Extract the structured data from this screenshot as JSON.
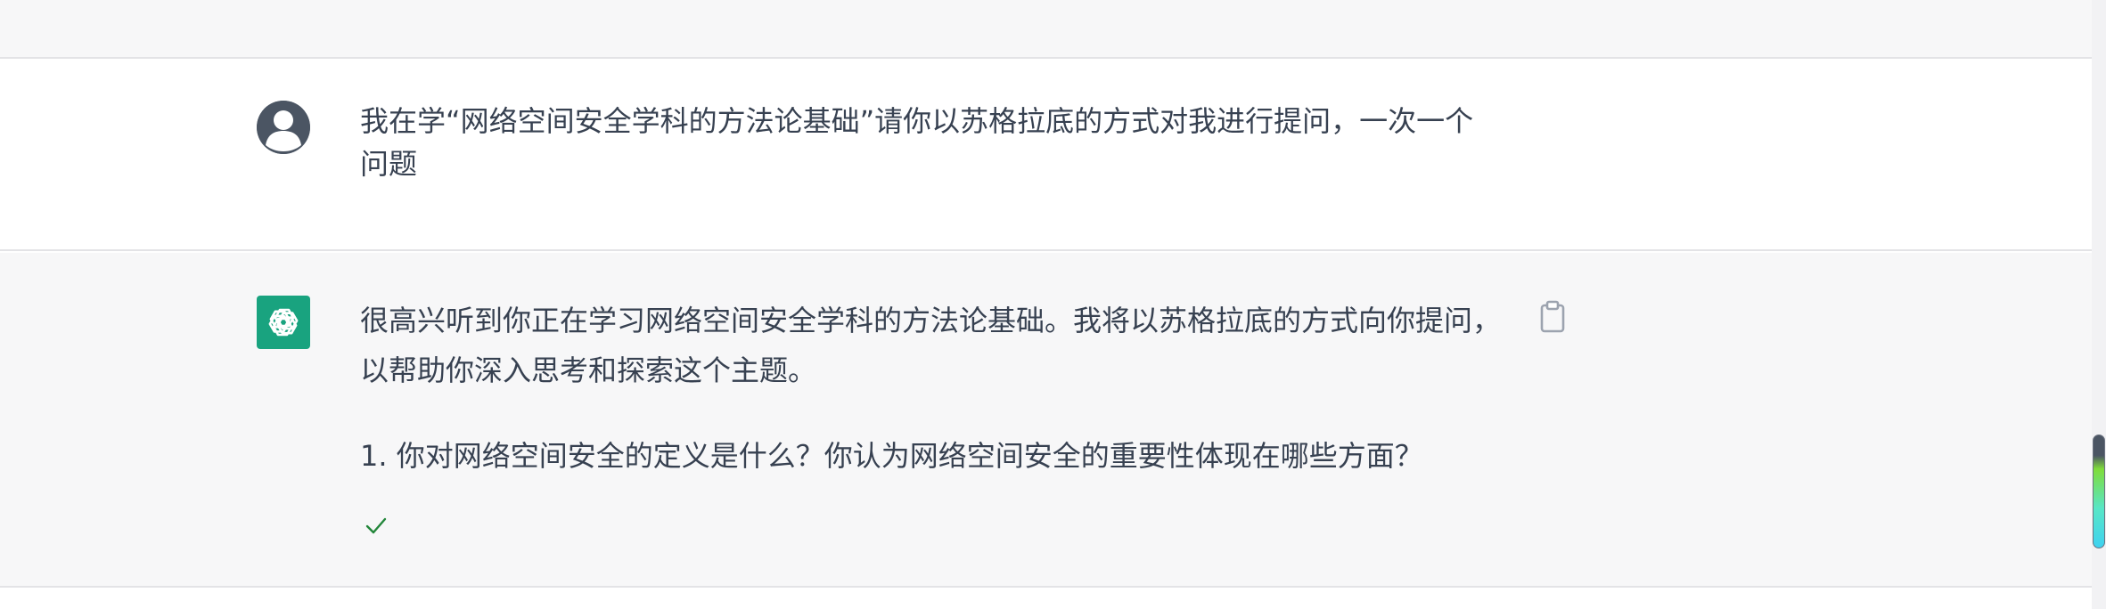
{
  "conversation": {
    "user_message": {
      "text": "我在学“网络空间安全学科的方法论基础”请你以苏格拉底的方式对我进行提问，一次一个问题"
    },
    "assistant_message": {
      "paragraph_1": "很高兴听到你正在学习网络空间安全学科的方法论基础。我将以苏格拉底的方式向你提问，以帮助你深入思考和探索这个主题。",
      "paragraph_2": "1. 你对网络空间安全的定义是什么？你认为网络空间安全的重要性体现在哪些方面？"
    }
  },
  "icons": {
    "user_avatar": "user-silhouette-icon",
    "assistant_avatar": "openai-logo-icon",
    "copy": "clipboard-icon",
    "status": "checkmark-icon"
  },
  "colors": {
    "assistant_brand": "#19a37f",
    "user_avatar_bg": "#4b5563",
    "assistant_row_bg": "#f7f7f8",
    "text": "#374151",
    "check": "#22863a"
  }
}
